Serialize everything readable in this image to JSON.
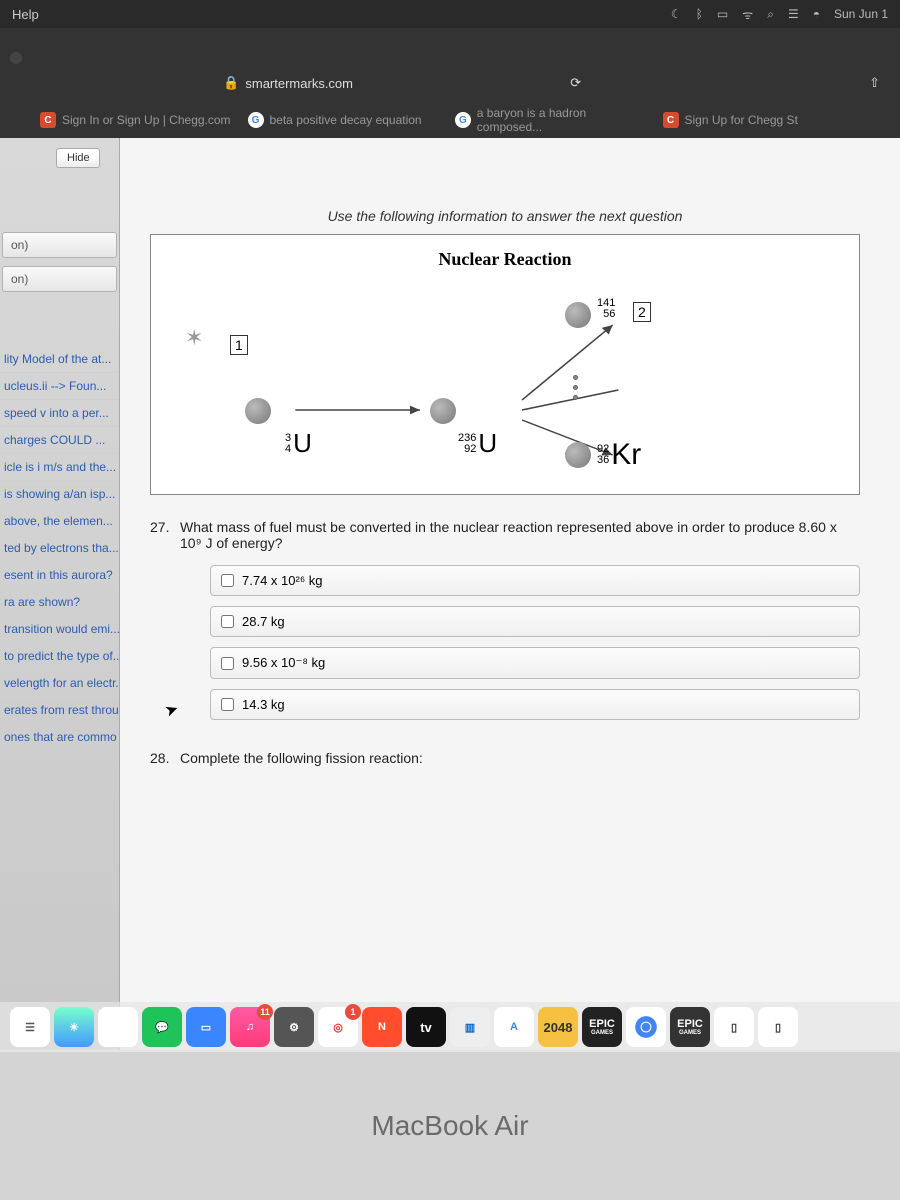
{
  "menubar": {
    "help": "Help",
    "date": "Sun Jun 1"
  },
  "browser": {
    "url": "smartermarks.com",
    "bookmarks": [
      {
        "icon": "C",
        "label": "Sign In or Sign Up | Chegg.com"
      },
      {
        "icon": "G",
        "label": "beta positive decay equation"
      },
      {
        "icon": "G",
        "label": "a baryon is a hadron composed..."
      },
      {
        "icon": "C",
        "label": "Sign Up for Chegg St"
      }
    ]
  },
  "sidebar": {
    "hide": "Hide",
    "nav": [
      "on)",
      "on)"
    ],
    "items": [
      "lity Model of the at...",
      "ucleus.ii --> Foun...",
      "speed v into a per...",
      "charges COULD ...",
      "icle is i m/s and the...",
      "is showing a/an isp...",
      "above, the elemen...",
      "ted by electrons tha...",
      "esent in this aurora?",
      "ra are shown?",
      "transition would emi...",
      "to predict the type of...",
      "velength for an electr...",
      "erates from rest throu...",
      "ones that are commo"
    ]
  },
  "page": {
    "info": "Use the following information to answer the next question",
    "diagram_title": "Nuclear Reaction",
    "isotopes": {
      "u_left": {
        "top": "3",
        "bottom": "4",
        "sym": "U"
      },
      "u_mid": {
        "top": "236",
        "bottom": "92",
        "sym": "U"
      },
      "top": {
        "top": "141",
        "bottom": "56",
        "box": "2"
      },
      "kr": {
        "top": "92",
        "bottom": "36",
        "sym": "Kr"
      },
      "box1": "1"
    },
    "q27": {
      "num": "27.",
      "text": "What mass of fuel must be converted in the nuclear reaction represented above in order to produce 8.60 x 10⁹ J of energy?",
      "options": [
        "7.74 x 10²⁶ kg",
        "28.7 kg",
        "9.56 x 10⁻⁸ kg",
        "14.3 kg"
      ]
    },
    "q28": {
      "num": "28.",
      "text": "Complete the following fission reaction:"
    }
  },
  "dock": {
    "badge_music": "11",
    "badge_target": "1",
    "tv": "tv",
    "game": "2048",
    "epic": "EPIC",
    "epic_sub": "GAMES"
  },
  "keyboard": {
    "brand": "MacBook Air"
  }
}
